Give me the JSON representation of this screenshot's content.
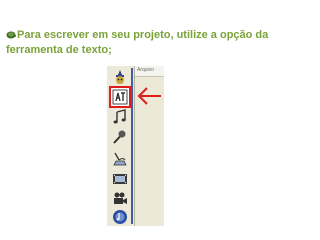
{
  "caption": {
    "text": "Para escrever em seu projeto, utilize a opção da ferramenta de texto;",
    "color": "#7aa33a"
  },
  "screenshot": {
    "menu_label": "Arquivo",
    "tools": [
      {
        "icon": "wizard-icon",
        "selected": false
      },
      {
        "icon": "text-tool-icon",
        "selected": true
      },
      {
        "icon": "music-note-icon",
        "selected": false
      },
      {
        "icon": "microphone-icon",
        "selected": false
      },
      {
        "icon": "narration-icon",
        "selected": false
      },
      {
        "icon": "film-strip-icon",
        "selected": false
      },
      {
        "icon": "video-camera-icon",
        "selected": false
      },
      {
        "icon": "audio-cd-icon",
        "selected": false
      }
    ]
  },
  "colors": {
    "highlight": "#e01b1b",
    "arrow": "#e01b1b",
    "toolbar_bg": "#ece9d8",
    "divider": "#3f5f9e"
  }
}
